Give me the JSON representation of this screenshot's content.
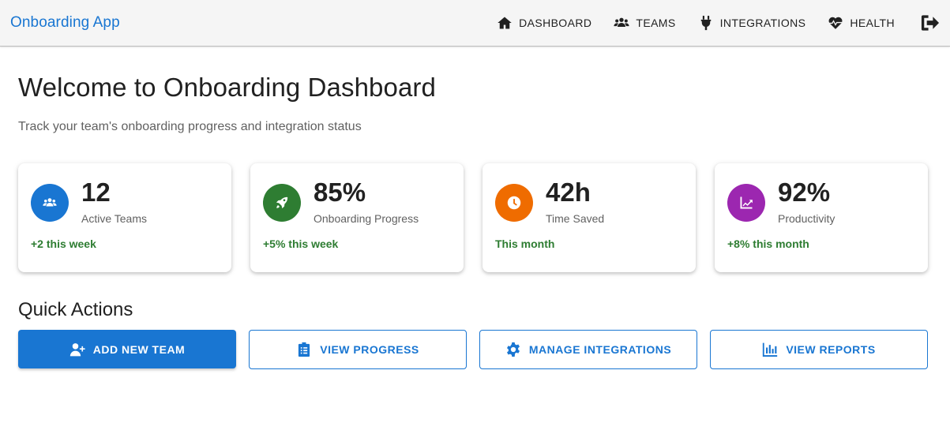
{
  "appbar": {
    "brand": "Onboarding App",
    "nav": [
      {
        "label": "DASHBOARD",
        "icon": "home-icon"
      },
      {
        "label": "TEAMS",
        "icon": "users-icon"
      },
      {
        "label": "INTEGRATIONS",
        "icon": "plug-icon"
      },
      {
        "label": "HEALTH",
        "icon": "heart-pulse-icon"
      }
    ],
    "logout_icon": "logout-icon"
  },
  "header": {
    "title": "Welcome to Onboarding Dashboard",
    "subtitle": "Track your team's onboarding progress and integration status"
  },
  "stats": [
    {
      "value": "12",
      "label": "Active Teams",
      "trend": "+2 this week",
      "icon": "users-icon",
      "color": "#1976d2"
    },
    {
      "value": "85%",
      "label": "Onboarding Progress",
      "trend": "+5% this week",
      "icon": "rocket-icon",
      "color": "#2e7d32"
    },
    {
      "value": "42h",
      "label": "Time Saved",
      "trend": "This month",
      "icon": "clock-icon",
      "color": "#ef6c00"
    },
    {
      "value": "92%",
      "label": "Productivity",
      "trend": "+8% this month",
      "icon": "trending-up-icon",
      "color": "#9c27b0"
    }
  ],
  "quick_actions": {
    "title": "Quick Actions",
    "buttons": [
      {
        "label": "ADD NEW TEAM",
        "icon": "user-plus-icon"
      },
      {
        "label": "VIEW PROGRESS",
        "icon": "clipboard-list-icon"
      },
      {
        "label": "MANAGE INTEGRATIONS",
        "icon": "gear-icon"
      },
      {
        "label": "VIEW REPORTS",
        "icon": "bar-chart-icon"
      }
    ]
  },
  "colors": {
    "primary": "#1976d2",
    "success": "#2e7d32",
    "appbar_bg": "#f5f5f5"
  }
}
